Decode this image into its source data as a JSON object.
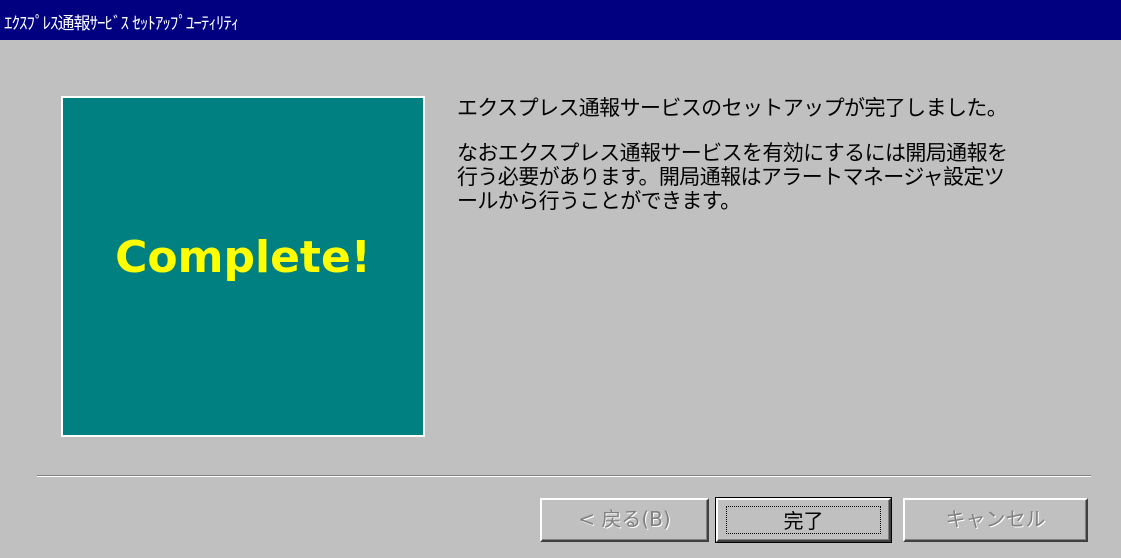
{
  "window": {
    "title": "ｴｸｽﾌﾟﾚｽ通報ｻｰﾋﾞｽ ｾｯﾄｱｯﾌﾟﾕｰﾃｨﾘﾃｨ"
  },
  "graphic": {
    "text": "Complete!",
    "background_color": "#008080",
    "text_color": "#ffff00"
  },
  "main": {
    "message1": "エクスプレス通報サービスのセットアップが完了しました。",
    "message2_lines": [
      "なおエクスプレス通報サービスを有効にするには開局通報を",
      "行う必要があります。開局通報はアラートマネージャ設定ツ",
      "ールから行うことができます。"
    ]
  },
  "buttons": {
    "back_label": "< 戻る(B)",
    "finish_label": "完了",
    "cancel_label": "キャンセル"
  },
  "colors": {
    "title_bar": "#000080",
    "dialog_face": "#c0c0c0"
  }
}
